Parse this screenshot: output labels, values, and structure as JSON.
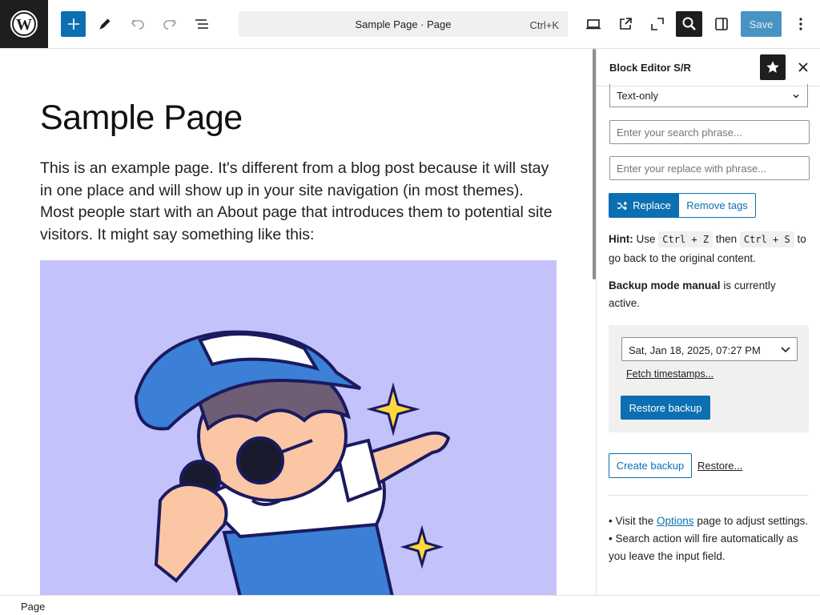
{
  "toolbar": {
    "command_title": "Sample Page · Page",
    "command_shortcut": "Ctrl+K",
    "save_label": "Save"
  },
  "canvas": {
    "title": "Sample Page",
    "body": "This is an example page. It's different from a blog post because it will stay in one place and will show up in your site navigation (in most themes). Most people start with an About page that introduces them to potential site visitors. It might say something like this:"
  },
  "sidebar": {
    "title": "Block Editor S/R",
    "mode_select": "Text-only",
    "search_placeholder": "Enter your search phrase...",
    "replace_placeholder": "Enter your replace with phrase...",
    "replace_label": "Replace",
    "remove_tags_label": "Remove tags",
    "hint_label": "Hint:",
    "hint_use": "Use",
    "hint_key1": "Ctrl + Z",
    "hint_then": "then",
    "hint_key2": "Ctrl + S",
    "hint_tail": "to go back to the original content.",
    "backup_mode_bold": "Backup mode manual",
    "backup_mode_tail": "is currently active.",
    "timestamp_value": "Sat, Jan 18, 2025, 07:27 PM",
    "fetch_label": "Fetch timestamps...",
    "restore_backup_label": "Restore backup",
    "create_backup_label": "Create backup",
    "restore_link_label": "Restore...",
    "note1_pre": "• Visit the",
    "note1_link": "Options",
    "note1_post": "page to adjust settings.",
    "note2": "• Search action will fire automatically as you leave the input field."
  },
  "footer": {
    "breadcrumb": "Page"
  },
  "colors": {
    "accent": "#0c6fb1",
    "dark": "#1e1e1e",
    "hero_bg": "#c4c2fb"
  }
}
